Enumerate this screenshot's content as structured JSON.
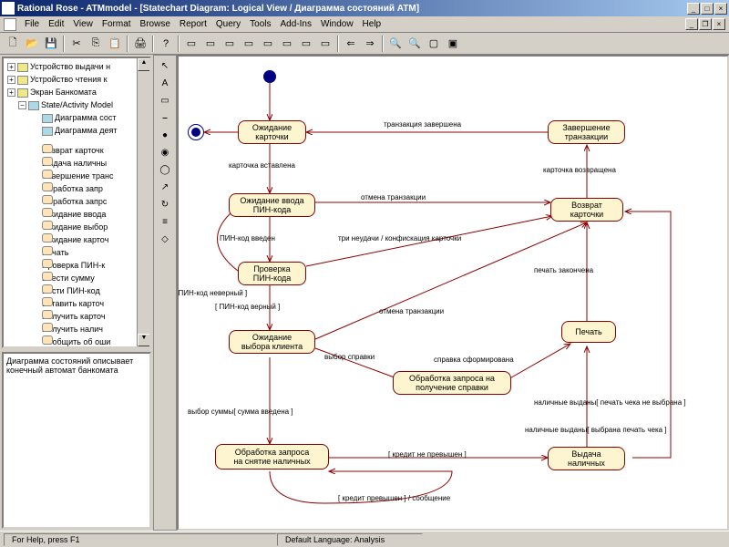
{
  "window": {
    "title": "Rational Rose - ATMmodel - [Statechart Diagram: Logical View / Диаграмма состояний ATM]"
  },
  "menu": {
    "file": "File",
    "edit": "Edit",
    "view": "View",
    "format": "Format",
    "browse": "Browse",
    "report": "Report",
    "query": "Query",
    "tools": "Tools",
    "addins": "Add-Ins",
    "window": "Window",
    "help": "Help"
  },
  "tree": {
    "n0": "Устройство выдачи н",
    "n1": "Устройство чтения к",
    "n2": "Экран Банкомата",
    "n3": "State/Activity Model",
    "n3a": "Диаграмма сост",
    "n3b": "Диаграмма деят",
    "n4": "Возврат карточк",
    "n5": "Выдача наличны",
    "n6": "Завершение транс",
    "n7": "Обработка запр",
    "n8": "Обработка запрс",
    "n9": "Ожидание ввода",
    "n10": "Ожидание выбор",
    "n11": "Ожидание карточ",
    "n12": "Печать",
    "n13": "Проверка ПИН-к",
    "n14": "Ввести сумму",
    "n15": "Вести ПИН-код",
    "n16": "Вставить карточ",
    "n17": "Получить карточ",
    "n18": "Получить налич",
    "n19": "Сообщить об оши"
  },
  "description": "Диаграмма состояний описывает конечный автомат банкомата",
  "states": {
    "s1": "Ожидание\nкарточки",
    "s2": "Завершение\nтранзакции",
    "s3": "Ожидание ввода\nПИН-кода",
    "s4": "Возврат\nкарточки",
    "s5": "Проверка\nПИН-кода",
    "s6": "Ожидание\nвыбора клиента",
    "s7": "Печать",
    "s8": "Обработка запроса на\nполучение справки",
    "s9": "Обработка запроса\nна снятие наличных",
    "s10": "Выдача\nналичных"
  },
  "transitions": {
    "t1": "транзакция завершена",
    "t2": "карточка вставлена",
    "t3": "карточка возвращена",
    "t4": "отмена транзакции",
    "t5": "ПИН-код введен",
    "t6": "три неудачи / конфискация карточки",
    "t7": "[ ПИН-код неверный ]",
    "t8": "[ ПИН-код верный ]",
    "t9": "отмена транзакции",
    "t10": "печать закончена",
    "t11": "выбор справки",
    "t12": "справка сформирована",
    "t13": "наличные выданы[ печать чека не выбрана ]",
    "t14": "выбор суммы[ сумма введена ]",
    "t15": "наличные выданы[ выбрана печать чека ]",
    "t16": "[ кредит не превышен ]",
    "t17": "[ кредит превышен ] / сообщение"
  },
  "status": {
    "help": "For Help, press F1",
    "lang": "Default Language: Analysis"
  }
}
